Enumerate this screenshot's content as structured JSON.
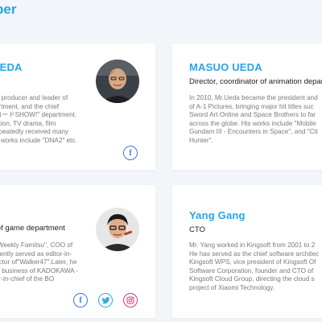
{
  "section": {
    "title": "ber"
  },
  "cards": [
    {
      "name": "AEDA",
      "role": "",
      "bio": [
        "V producer and leader of",
        "artment, and the chief",
        "ロードSHOW!\" department.",
        "ation, TV drama, film",
        "epeatedly received many",
        "e works include \"DNA2\" etc."
      ],
      "social": [
        {
          "icon": "facebook-icon",
          "glyph": "f"
        }
      ]
    },
    {
      "name": "MASUO UEDA",
      "role": "Director, coordinator of animation depar",
      "bio": [
        "In 2010, Mr.Ueda became the president and",
        "of A-1 Pictures, bringing major hit titles suc",
        "Sword Art Online and Space Brothers to far",
        "across the globe. His works include \"Mobile",
        "Gundam III - Encounters in Space\", and \"Cit",
        "Hunter\"."
      ],
      "social": []
    },
    {
      "name": "O",
      "role": "r of game department",
      "bio": [
        "\"Weekly Famitsu\", COO of",
        "rrently served as editor-in-",
        "ector of\"Walker47\".Later, he",
        "w business of KADOKAWA -",
        "or-in-chief of the BO"
      ],
      "social": [
        {
          "icon": "facebook-icon",
          "glyph": "f"
        },
        {
          "icon": "twitter-icon",
          "glyph": ""
        },
        {
          "icon": "instagram-icon",
          "glyph": ""
        }
      ]
    },
    {
      "name": "Yang Gang",
      "role": "CTO",
      "bio": [
        "Mr. Yang worked in Kingsoft from 2001 to 2",
        "He has served as the chief software architec",
        "Kingsoft WPS, vice president of Kingsoft Of",
        "Software Corporation, founder and CTO of",
        "Kingsoft Cloud Group, directing the cloud s",
        "project of Xiaomi Technology."
      ],
      "social": []
    }
  ],
  "colors": {
    "accent": "#2aa3e8",
    "background": "#f2f5f9",
    "facebook": "#3a7bd5",
    "twitter": "#31a8e6",
    "instagram": "#d4387a"
  }
}
